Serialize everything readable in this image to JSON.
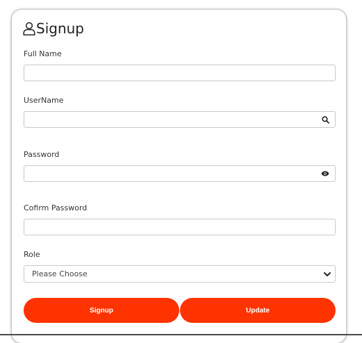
{
  "form": {
    "title": "Signup",
    "fields": [
      {
        "label": "Full Name",
        "value": "",
        "placeholder": ""
      },
      {
        "label": "UserName",
        "value": "",
        "placeholder": "",
        "trailing_icon": "search-icon"
      },
      {
        "label": "Password",
        "value": "",
        "placeholder": "",
        "trailing_icon": "eye-icon"
      },
      {
        "label": "Cofirm Password",
        "value": "",
        "placeholder": ""
      }
    ],
    "role": {
      "label": "Role",
      "selected": "Please Choose"
    },
    "buttons": {
      "signup_label": "Signup",
      "update_label": "Update"
    }
  },
  "colors": {
    "accent": "#ff3300",
    "border": "#c9c9c9"
  }
}
